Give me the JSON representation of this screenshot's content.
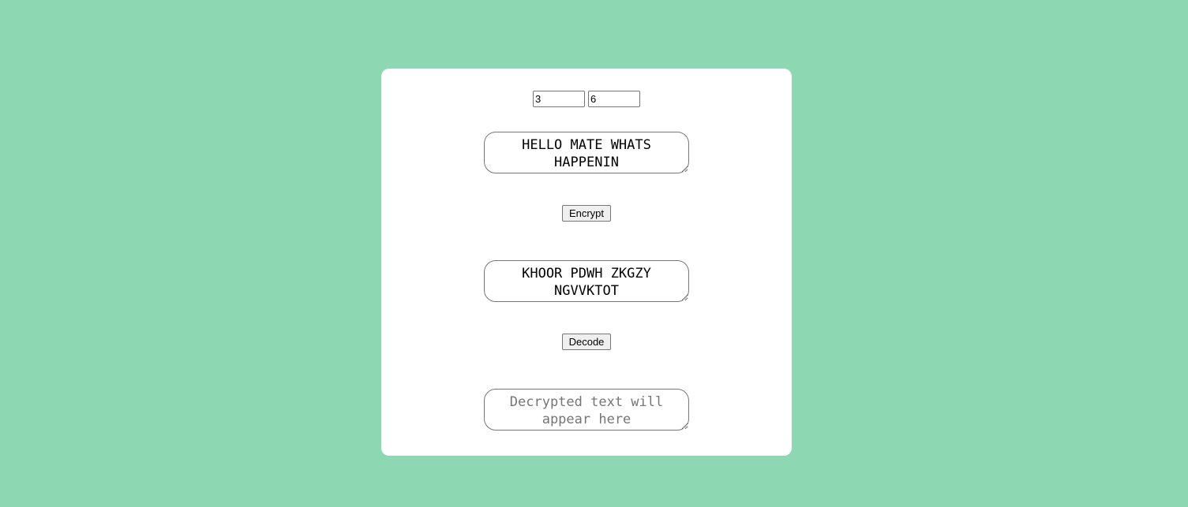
{
  "keys": {
    "first_value": "3",
    "second_value": "6"
  },
  "plaintext": {
    "value": "HELLO MATE WHATS HAPPENIN"
  },
  "encrypt_button": {
    "label": "Encrypt"
  },
  "ciphertext": {
    "value": "KHOOR PDWH ZKGZY NGVVKTOT"
  },
  "decode_button": {
    "label": "Decode"
  },
  "decrypted": {
    "value": "",
    "placeholder": "Decrypted text will appear here"
  },
  "colors": {
    "background": "#8dd8b3",
    "card": "#ffffff",
    "border": "#767676"
  }
}
